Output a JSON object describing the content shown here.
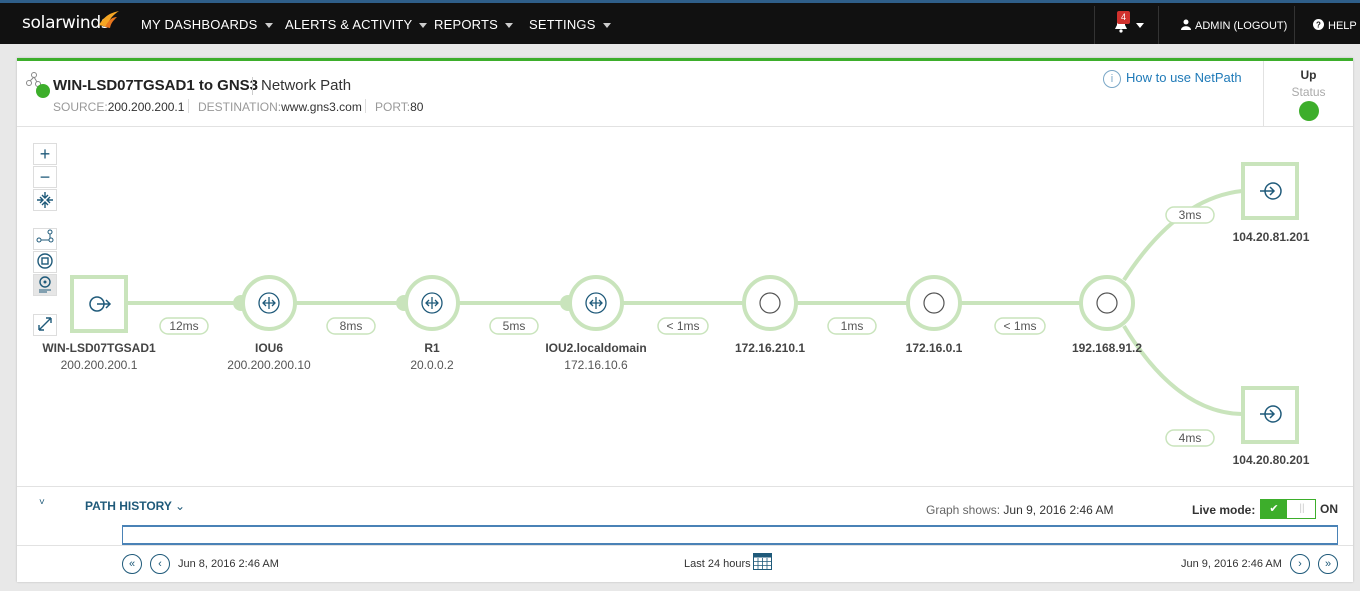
{
  "nav": {
    "logo": "solarwinds",
    "items": [
      "MY DASHBOARDS",
      "ALERTS & ACTIVITY",
      "REPORTS",
      "SETTINGS"
    ],
    "notifications": "4",
    "admin": "ADMIN (LOGOUT)",
    "help": "HELP"
  },
  "header": {
    "title": "WIN-LSD07TGSAD1 to GNS3",
    "subtitle": "Network Path",
    "source_label": "SOURCE:",
    "source": "200.200.200.1",
    "dest_label": "DESTINATION:",
    "dest": "www.gns3.com",
    "port_label": "PORT:",
    "port": "80",
    "howto": "How to use NetPath",
    "status_value": "Up",
    "status_label": "Status"
  },
  "path": {
    "nodes": [
      {
        "name": "WIN-LSD07TGSAD1",
        "ip": "200.200.200.1",
        "kind": "source"
      },
      {
        "name": "IOU6",
        "ip": "200.200.200.10",
        "kind": "router"
      },
      {
        "name": "R1",
        "ip": "20.0.0.2",
        "kind": "router"
      },
      {
        "name": "IOU2.localdomain",
        "ip": "172.16.10.6",
        "kind": "router"
      },
      {
        "name": "172.16.210.1",
        "ip": "",
        "kind": "hop"
      },
      {
        "name": "172.16.0.1",
        "ip": "",
        "kind": "hop"
      },
      {
        "name": "192.168.91.2",
        "ip": "",
        "kind": "hop"
      },
      {
        "name": "104.20.81.201",
        "ip": "",
        "kind": "dest"
      },
      {
        "name": "104.20.80.201",
        "ip": "",
        "kind": "dest"
      }
    ],
    "latencies": [
      "12ms",
      "8ms",
      "5ms",
      "< 1ms",
      "1ms",
      "< 1ms",
      "3ms",
      "4ms"
    ]
  },
  "history": {
    "title": "PATH HISTORY",
    "graph_shows_label": "Graph shows:",
    "graph_shows": "Jun 9, 2016 2:46 AM",
    "live_label": "Live mode:",
    "live_state": "ON",
    "start": "Jun 8, 2016 2:46 AM",
    "range": "Last 24 hours",
    "end": "Jun 9, 2016 2:46 AM"
  },
  "colors": {
    "accent": "#3dae2b",
    "path": "#c9e4bc",
    "link": "#1f7ab8"
  }
}
